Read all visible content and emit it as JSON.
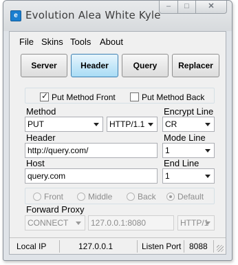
{
  "window": {
    "title": "Evolution Alea White Kyle"
  },
  "menu": [
    "File",
    "Skins",
    "Tools",
    "About"
  ],
  "tabs": [
    {
      "label": "Server",
      "active": false
    },
    {
      "label": "Header",
      "active": true
    },
    {
      "label": "Query",
      "active": false
    },
    {
      "label": "Replacer",
      "active": false
    }
  ],
  "options": {
    "put_method_front": {
      "label": "Put Method Front",
      "checked": true
    },
    "put_method_back": {
      "label": "Put Method Back",
      "checked": false
    }
  },
  "method": {
    "label": "Method",
    "value": "PUT",
    "protocol": "HTTP/1.1"
  },
  "encrypt_line": {
    "label": "Encrypt Line",
    "value": "CR"
  },
  "header": {
    "label": "Header",
    "value": "http://query.com/"
  },
  "mode_line": {
    "label": "Mode Line",
    "value": "1"
  },
  "host": {
    "label": "Host",
    "value": "query.com"
  },
  "end_line": {
    "label": "End Line",
    "value": "1"
  },
  "position": {
    "options": [
      "Front",
      "Middle",
      "Back",
      "Default"
    ],
    "selected": "Default"
  },
  "forward_proxy": {
    "label": "Forward Proxy",
    "method": "CONNECT",
    "address": "127.0.0.1:8080",
    "protocol": "HTTP/1"
  },
  "status": {
    "local_ip_label": "Local IP",
    "local_ip": "127.0.0.1",
    "listen_port_label": "Listen Port",
    "listen_port": "8088"
  },
  "colors": {
    "active_tab": "#a9dcf5",
    "window_frame": "#dfe3e8"
  }
}
